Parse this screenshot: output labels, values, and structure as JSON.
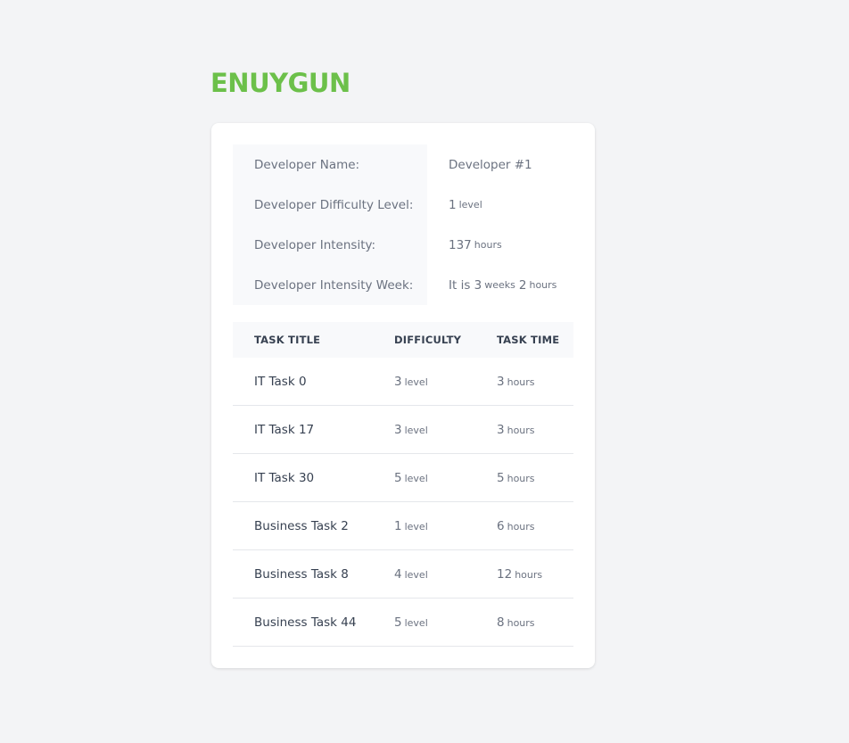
{
  "brand": {
    "logo_text": "ENUYGUN",
    "color": "#6cc04a"
  },
  "developer": {
    "name_label": "Developer Name:",
    "name_value": "Developer #1",
    "difficulty_label": "Developer Difficulty Level:",
    "difficulty_value": "1",
    "difficulty_unit": "level",
    "intensity_label": "Developer Intensity:",
    "intensity_value": "137",
    "intensity_unit": "hours",
    "week_label": "Developer Intensity Week:",
    "week_prefix": "It is",
    "week_weeks": "3",
    "week_weeks_unit": "weeks",
    "week_hours": "2",
    "week_hours_unit": "hours"
  },
  "table": {
    "headers": [
      "TASK TITLE",
      "DIFFICULTY",
      "TASK TIME"
    ],
    "level_unit": "level",
    "time_unit": "hours",
    "rows": [
      {
        "title": "IT Task 0",
        "difficulty": "3",
        "time": "3"
      },
      {
        "title": "IT Task 17",
        "difficulty": "3",
        "time": "3"
      },
      {
        "title": "IT Task 30",
        "difficulty": "5",
        "time": "5"
      },
      {
        "title": "Business Task 2",
        "difficulty": "1",
        "time": "6"
      },
      {
        "title": "Business Task 8",
        "difficulty": "4",
        "time": "12"
      },
      {
        "title": "Business Task 44",
        "difficulty": "5",
        "time": "8"
      }
    ]
  }
}
